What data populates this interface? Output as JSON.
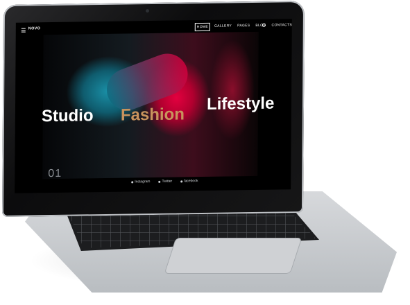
{
  "site": {
    "logo": "NOVO",
    "nav": [
      "HOME",
      "GALLERY",
      "PAGES",
      "BLOG",
      "CONTACTS"
    ],
    "active_nav": "HOME"
  },
  "hero": {
    "words": [
      "Studio",
      "Fashion",
      "Lifestyle"
    ],
    "slide_number": "01"
  },
  "social": [
    "Instagram",
    "Twitter",
    "facebook"
  ],
  "colors": {
    "accent": "#c8935d",
    "text": "#ffffff"
  }
}
